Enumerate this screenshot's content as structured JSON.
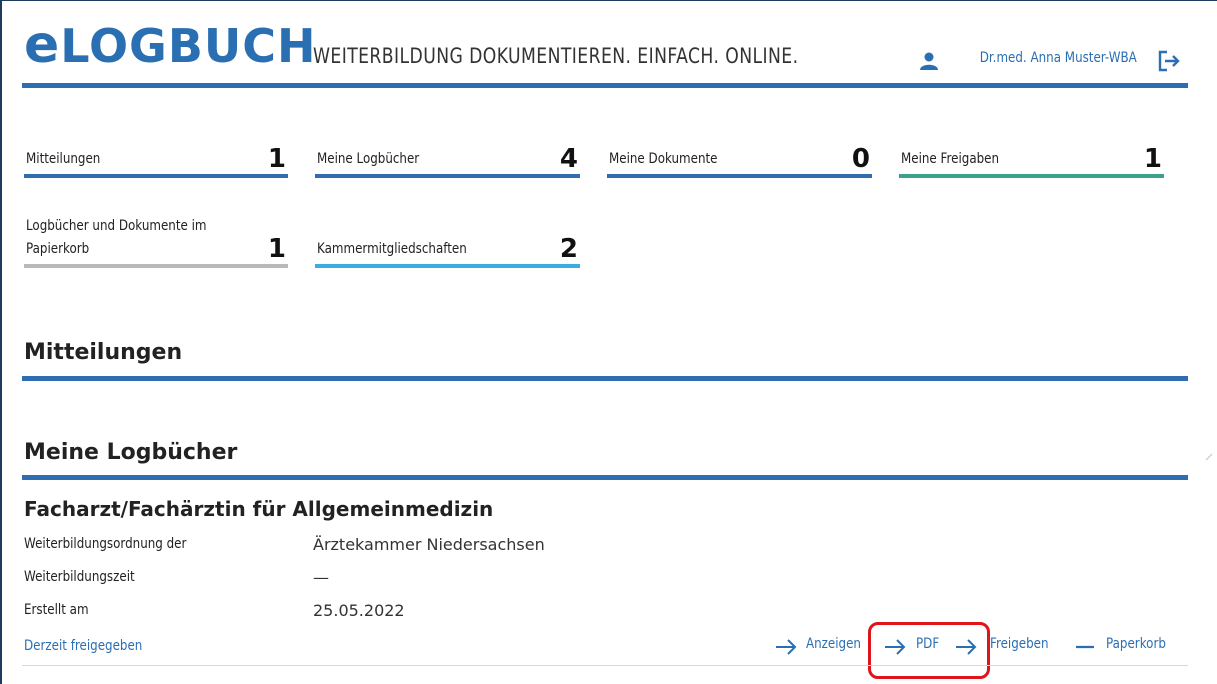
{
  "header": {
    "logo_e": "e",
    "logo_rest": "LOGBUCH",
    "tagline": "WEITERBILDUNG DOKUMENTIEREN. EINFACH. ONLINE.",
    "user_name": "Dr.med. Anna Muster-WBA",
    "icons": {
      "user": "user-icon",
      "logout": "logout-icon"
    }
  },
  "tiles": [
    {
      "label": "Mitteilungen",
      "count": "1",
      "color": "#2e6db0"
    },
    {
      "label": "Meine Logbücher",
      "count": "4",
      "color": "#2e6db0"
    },
    {
      "label": "Meine Dokumente",
      "count": "0",
      "color": "#2e6db0"
    },
    {
      "label": "Meine Freigaben",
      "count": "1",
      "color": "#3aa18d"
    },
    {
      "label_line1": "Logbücher und Dokumente im",
      "label_line2": "Papierkorb",
      "count": "1",
      "color": "#b8b8b8"
    },
    {
      "label": "Kammermitgliedschaften",
      "count": "2",
      "color": "#3aaee0"
    }
  ],
  "sections": {
    "messages_title": "Mitteilungen",
    "logbooks_title": "Meine Logbücher"
  },
  "logbook": {
    "title": "Facharzt/Fachärztin für Allgemeinmedizin",
    "rows": [
      {
        "label": "Weiterbildungsordnung der",
        "value": "Ärztekammer Niedersachsen"
      },
      {
        "label": "Weiterbildungszeit",
        "value": "—"
      },
      {
        "label": "Erstellt am",
        "value": "25.05.2022"
      }
    ],
    "status": "Derzeit freigegeben",
    "actions": {
      "show": "Anzeigen",
      "pdf": "PDF",
      "share": "Freigeben",
      "trash": "Paperkorb"
    }
  },
  "colors": {
    "accent": "#2e6db0",
    "link": "#2b6fb3",
    "highlight": "#e0141b"
  }
}
